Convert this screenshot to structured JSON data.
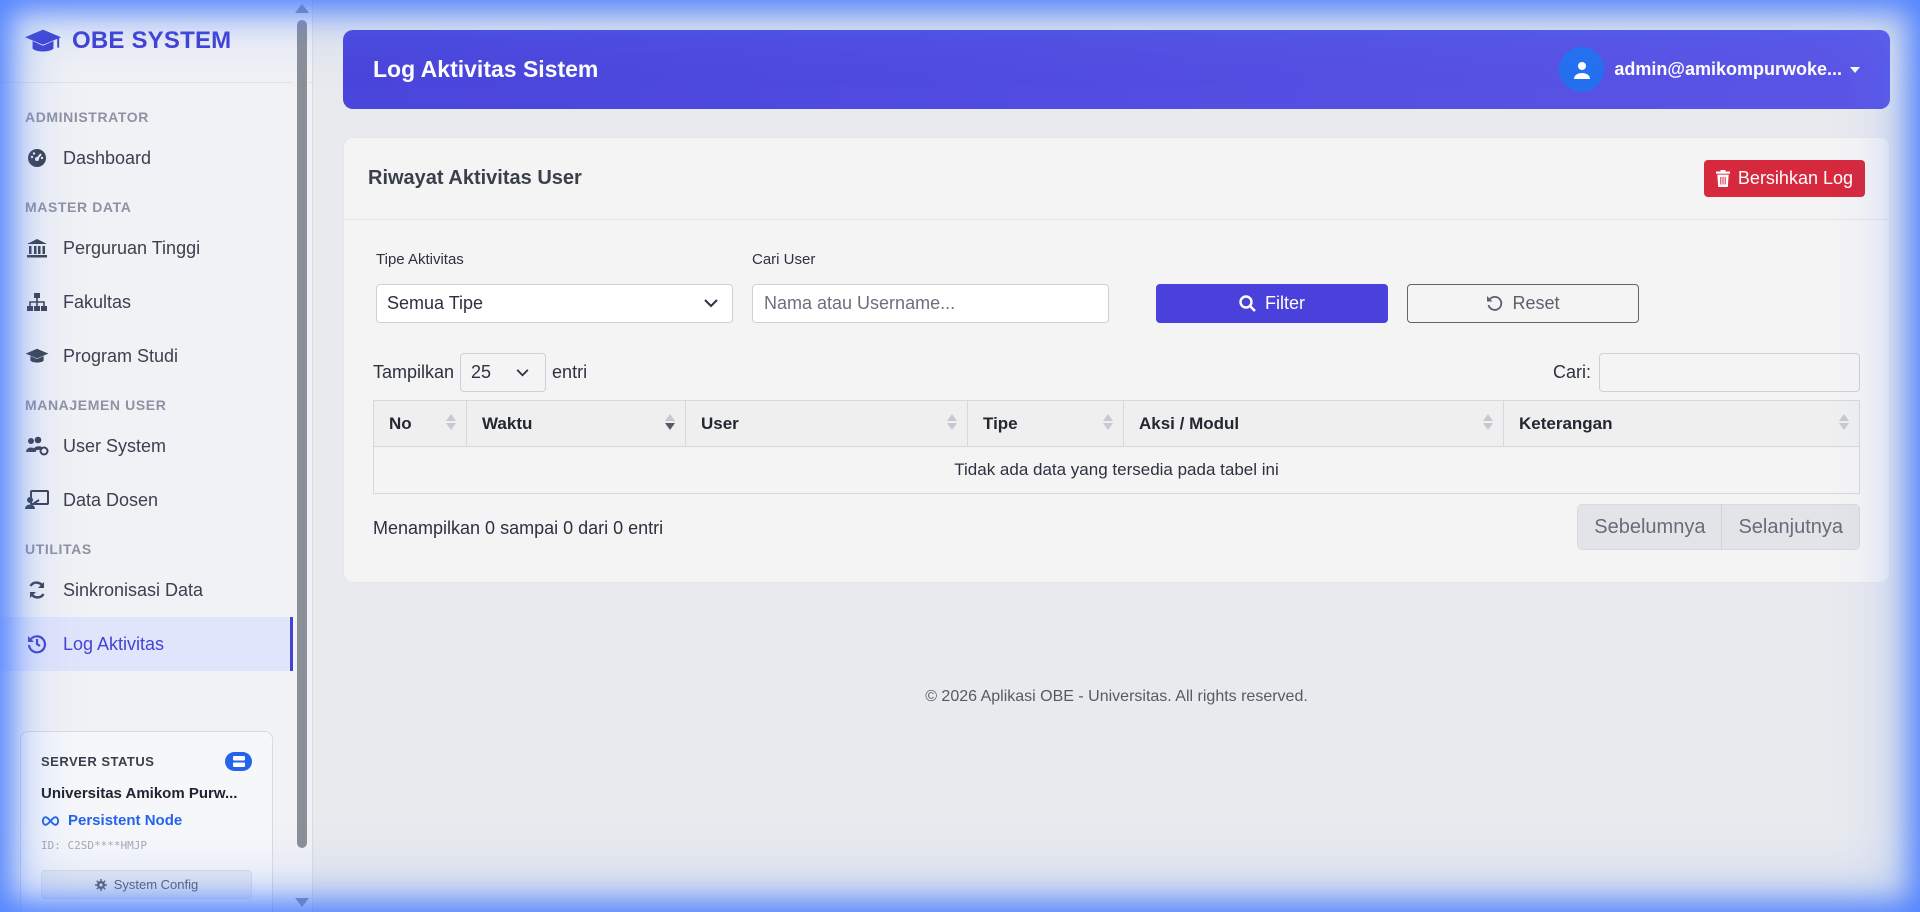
{
  "brand": {
    "name": "OBE SYSTEM"
  },
  "sidebar": {
    "sections": [
      {
        "heading": "ADMINISTRATOR",
        "items": [
          {
            "label": "Dashboard",
            "icon": "dashboard-icon"
          }
        ]
      },
      {
        "heading": "MASTER DATA",
        "items": [
          {
            "label": "Perguruan Tinggi",
            "icon": "university-icon"
          },
          {
            "label": "Fakultas",
            "icon": "sitemap-icon"
          },
          {
            "label": "Program Studi",
            "icon": "graduation-cap-icon"
          }
        ]
      },
      {
        "heading": "MANAJEMEN USER",
        "items": [
          {
            "label": "User System",
            "icon": "users-cog-icon"
          },
          {
            "label": "Data Dosen",
            "icon": "teacher-icon"
          }
        ]
      },
      {
        "heading": "UTILITAS",
        "items": [
          {
            "label": "Sinkronisasi Data",
            "icon": "sync-icon"
          },
          {
            "label": "Log Aktivitas",
            "icon": "history-icon",
            "active": true
          }
        ]
      }
    ]
  },
  "server_status": {
    "title": "SERVER STATUS",
    "university": "Universitas Amikom Purw...",
    "node": "Persistent Node",
    "id": "ID: C2SD****HMJP",
    "config_label": "System Config"
  },
  "header": {
    "title": "Log Aktivitas Sistem",
    "user": "admin@amikompurwoke..."
  },
  "card": {
    "title": "Riwayat Aktivitas User",
    "clear_button": "Bersihkan Log"
  },
  "filters": {
    "type_label": "Tipe Aktivitas",
    "type_value": "Semua Tipe",
    "user_label": "Cari User",
    "user_placeholder": "Nama atau Username...",
    "filter_button": "Filter",
    "reset_button": "Reset"
  },
  "table": {
    "length_prefix": "Tampilkan",
    "length_value": "25",
    "length_suffix": "entri",
    "search_label": "Cari:",
    "columns": [
      "No",
      "Waktu",
      "User",
      "Tipe",
      "Aksi / Modul",
      "Keterangan"
    ],
    "sorted_column": "Waktu",
    "sort_direction": "desc",
    "empty_message": "Tidak ada data yang tersedia pada tabel ini",
    "info": "Menampilkan 0 sampai 0 dari 0 entri",
    "prev": "Sebelumnya",
    "next": "Selanjutnya"
  },
  "footer": {
    "text": "© 2026 Aplikasi OBE - Universitas. All rights reserved."
  },
  "colors": {
    "accent": "#4a45db",
    "danger": "#d6293d",
    "info": "#2563eb"
  }
}
